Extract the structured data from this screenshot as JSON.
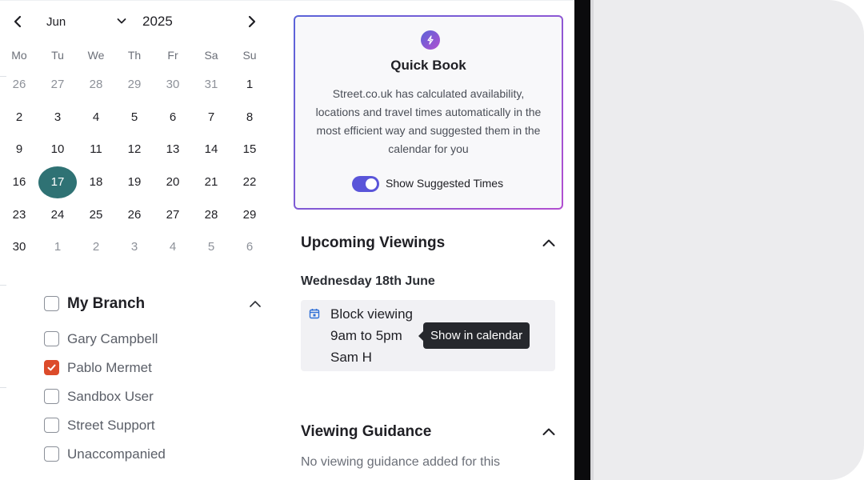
{
  "calendar": {
    "month": "Jun",
    "year": "2025",
    "weekdays": [
      "Mo",
      "Tu",
      "We",
      "Th",
      "Fr",
      "Sa",
      "Su"
    ],
    "weeks": [
      [
        "26",
        "27",
        "28",
        "29",
        "30",
        "31",
        "1"
      ],
      [
        "2",
        "3",
        "4",
        "5",
        "6",
        "7",
        "8"
      ],
      [
        "9",
        "10",
        "11",
        "12",
        "13",
        "14",
        "15"
      ],
      [
        "16",
        "17",
        "18",
        "19",
        "20",
        "21",
        "22"
      ],
      [
        "23",
        "24",
        "25",
        "26",
        "27",
        "28",
        "29"
      ],
      [
        "30",
        "1",
        "2",
        "3",
        "4",
        "5",
        "6"
      ]
    ],
    "selected_day": "17",
    "selected_color": "#2f7274"
  },
  "branch": {
    "title": "My Branch",
    "members": [
      {
        "name": "Gary Campbell",
        "checked": false
      },
      {
        "name": "Pablo Mermet",
        "checked": true
      },
      {
        "name": "Sandbox User",
        "checked": false
      },
      {
        "name": "Street Support",
        "checked": false
      },
      {
        "name": "Unaccompanied",
        "checked": false
      }
    ],
    "checked_color": "#dc4b2a"
  },
  "quick_book": {
    "icon": "lightning-icon",
    "title": "Quick Book",
    "description": "Street.co.uk has calculated availability, locations and travel times automatically in the most efficient way and suggested them in the calendar for you",
    "toggle_label": "Show Suggested Times",
    "toggle_on": true
  },
  "upcoming": {
    "title": "Upcoming Viewings",
    "date_heading": "Wednesday 18th June",
    "viewing": {
      "title": "Block viewing",
      "time": "9am to 5pm",
      "agent": "Sam H",
      "icon": "calendar-icon"
    },
    "tooltip": "Show in calendar"
  },
  "guidance": {
    "title": "Viewing Guidance",
    "text": "No viewing guidance added for this"
  }
}
